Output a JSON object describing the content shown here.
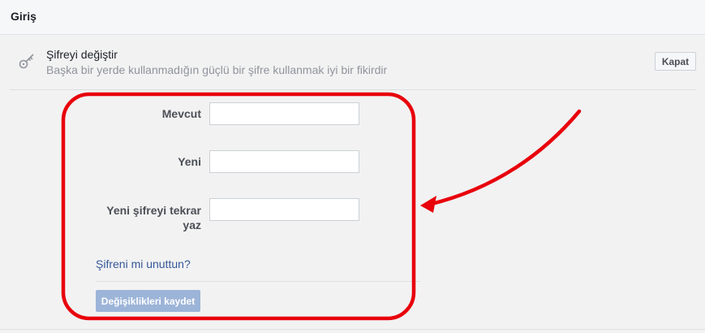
{
  "header": {
    "title": "Giriş"
  },
  "section": {
    "icon": "key-icon",
    "title": "Şifreyi değiştir",
    "subtitle": "Başka bir yerde kullanmadığın güçlü bir şifre kullanmak iyi bir fikirdir",
    "close_label": "Kapat"
  },
  "form": {
    "current_label": "Mevcut",
    "current_value": "",
    "new_label": "Yeni",
    "new_value": "",
    "repeat_label": "Yeni şifreyi tekrar yaz",
    "repeat_value": "",
    "forgot_link": "Şifreni mi unuttun?",
    "save_label": "Değişiklikleri kaydet"
  },
  "annotation": {
    "color": "#e8000b"
  }
}
